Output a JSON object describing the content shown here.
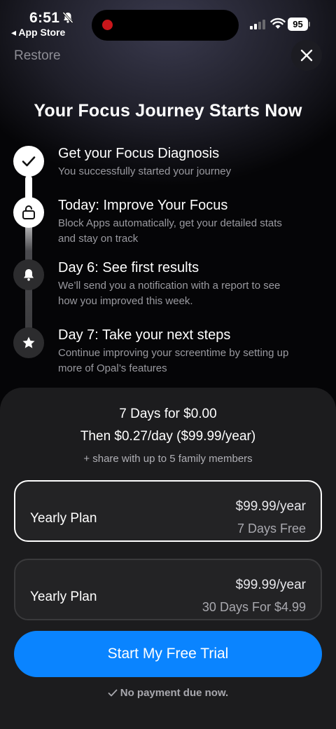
{
  "status_bar": {
    "time": "6:51",
    "back_label": "◂ App Store",
    "battery": "95"
  },
  "header": {
    "restore_label": "Restore",
    "close_icon": "close-icon"
  },
  "headline": "Your Focus Journey Starts Now",
  "steps": [
    {
      "icon": "checkmark-icon",
      "title": "Get your Focus Diagnosis",
      "desc": "You successfully started your journey"
    },
    {
      "icon": "unlock-icon",
      "title": "Today: Improve Your Focus",
      "desc": "Block Apps automatically, get your detailed stats and stay on track"
    },
    {
      "icon": "bell-icon",
      "title": "Day 6: See first results",
      "desc": "We’ll send you a notification with a report to see how you improved this week."
    },
    {
      "icon": "star-icon",
      "title": "Day 7: Take your next steps",
      "desc": "Continue improving your screentime by setting up more of Opal’s features"
    }
  ],
  "offer": {
    "line1": "7 Days for $0.00",
    "line2": "Then $0.27/day ($99.99/year)",
    "line3": "+ share with up to 5 family members"
  },
  "plans": [
    {
      "name": "Yearly Plan",
      "price": "$99.99/year",
      "sub": "7 Days Free",
      "selected": true
    },
    {
      "name": "Yearly Plan",
      "price": "$99.99/year",
      "sub": "30 Days For $4.99",
      "selected": false
    }
  ],
  "cta_label": "Start My Free Trial",
  "footnote": "No payment due now.",
  "colors": {
    "accent": "#0a84ff",
    "recording_dot": "#c9161b",
    "sheet": "#1c1c1e"
  }
}
